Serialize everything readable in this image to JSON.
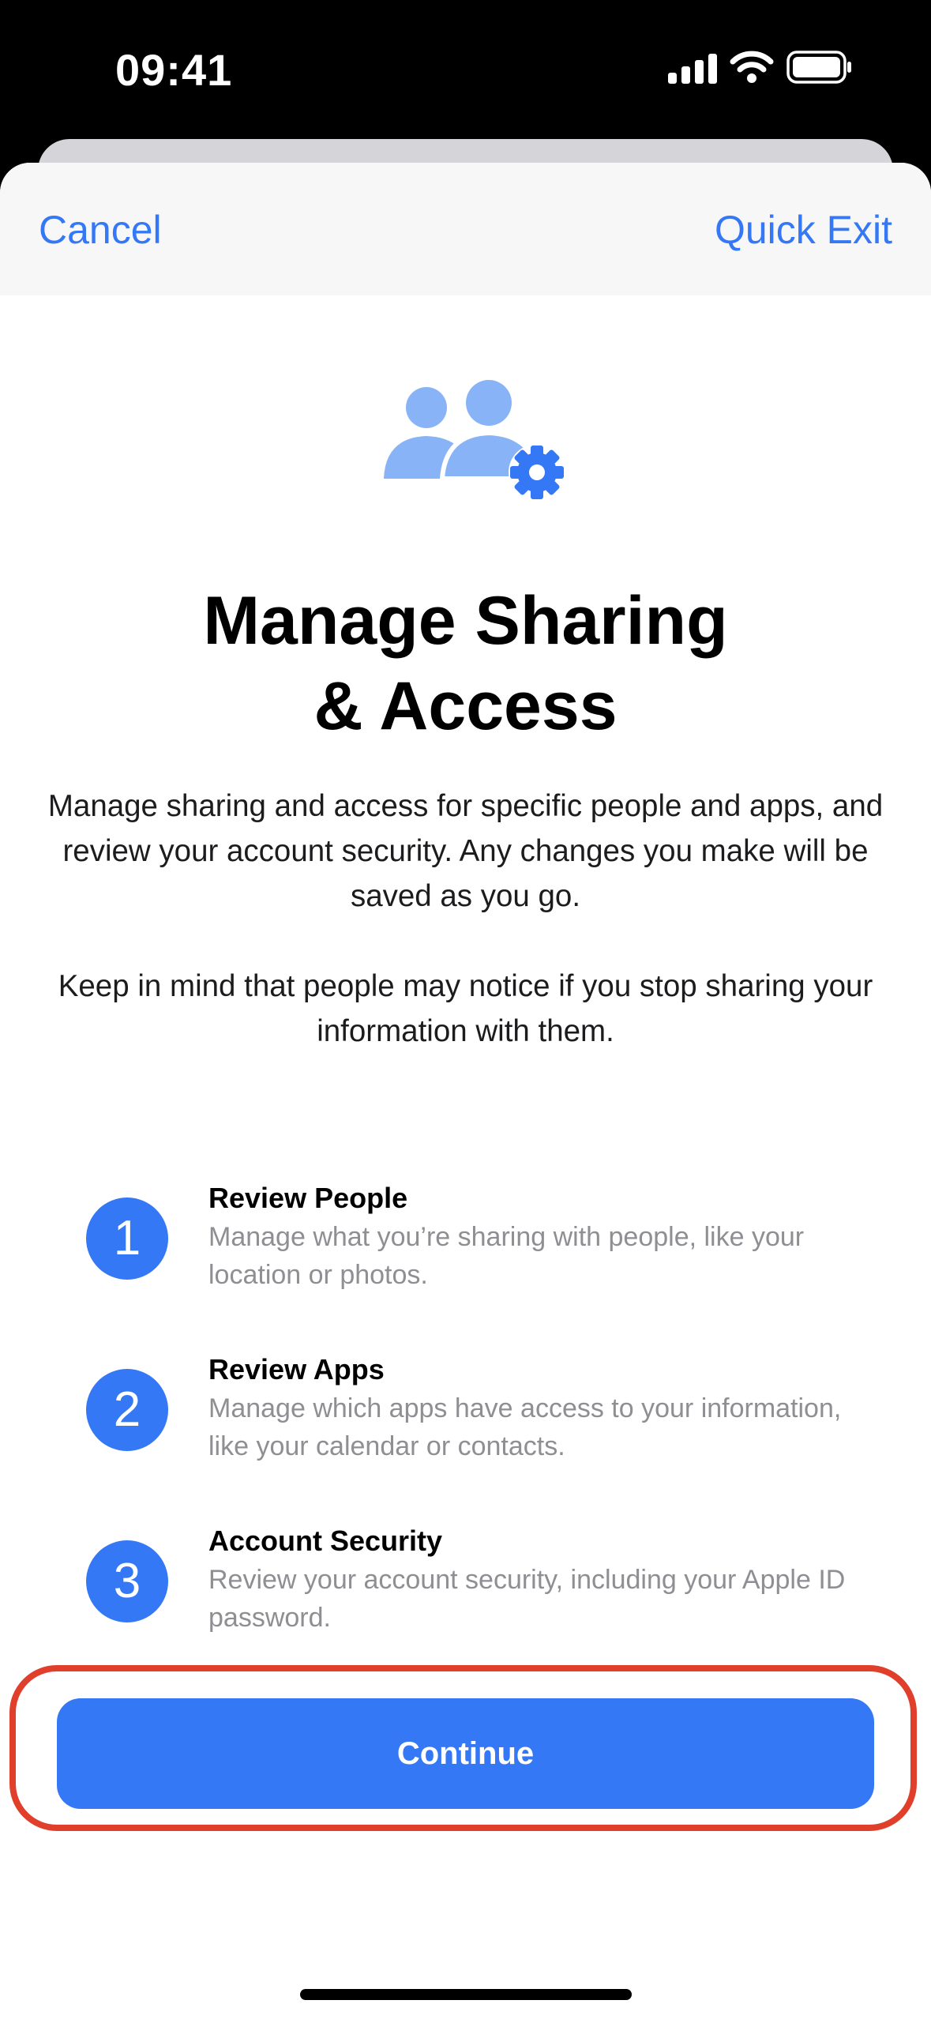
{
  "status_bar": {
    "time": "09:41"
  },
  "nav": {
    "cancel": "Cancel",
    "quick_exit": "Quick Exit"
  },
  "title_line1": "Manage Sharing",
  "title_line2": "& Access",
  "description": "Manage sharing and access for specific people and apps, and review your account security. Any changes you make will be saved as you go.",
  "note": "Keep in mind that people may notice if you stop sharing your information with them.",
  "steps": [
    {
      "number": "1",
      "title": "Review People",
      "desc": "Manage what you’re sharing with people, like your location or photos."
    },
    {
      "number": "2",
      "title": "Review Apps",
      "desc": "Manage which apps have access to your information, like your calendar or contacts."
    },
    {
      "number": "3",
      "title": "Account Security",
      "desc": "Review your account security, including your Apple ID password."
    }
  ],
  "continue_label": "Continue",
  "colors": {
    "accent": "#3478f6",
    "icon_light": "#88b4f7",
    "highlight": "#e0402b",
    "secondary_text": "#8e8e93"
  },
  "icons": {
    "hero": "people-gear-icon",
    "signal": "cellular-signal-icon",
    "wifi": "wifi-icon",
    "battery": "battery-icon"
  }
}
